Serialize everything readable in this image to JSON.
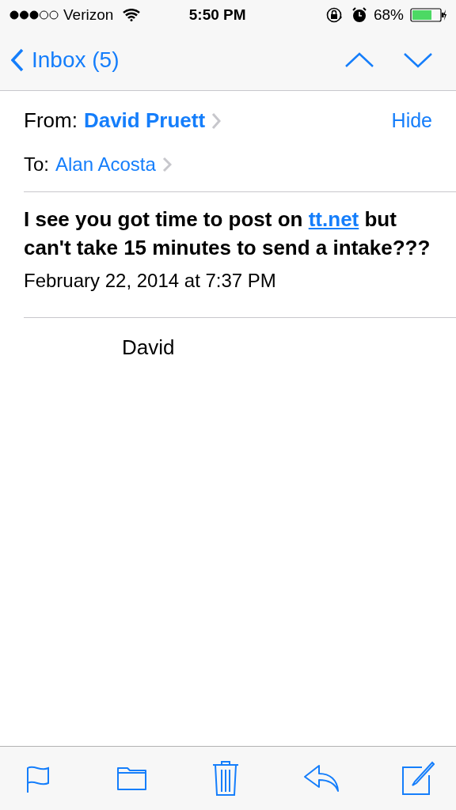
{
  "status_bar": {
    "carrier": "Verizon",
    "time": "5:50 PM",
    "battery": "68%"
  },
  "nav": {
    "back": "Inbox (5)"
  },
  "header": {
    "from_label": "From:",
    "from": "David Pruett",
    "hide": "Hide",
    "to_label": "To:",
    "to": "Alan Acosta"
  },
  "message": {
    "before": "I see you got time to post on",
    "link": "tt.net",
    "after": "but can't take 15 minutes to send a intake???",
    "date": "February 22, 2014 at 7:37 PM",
    "signature": "David"
  }
}
